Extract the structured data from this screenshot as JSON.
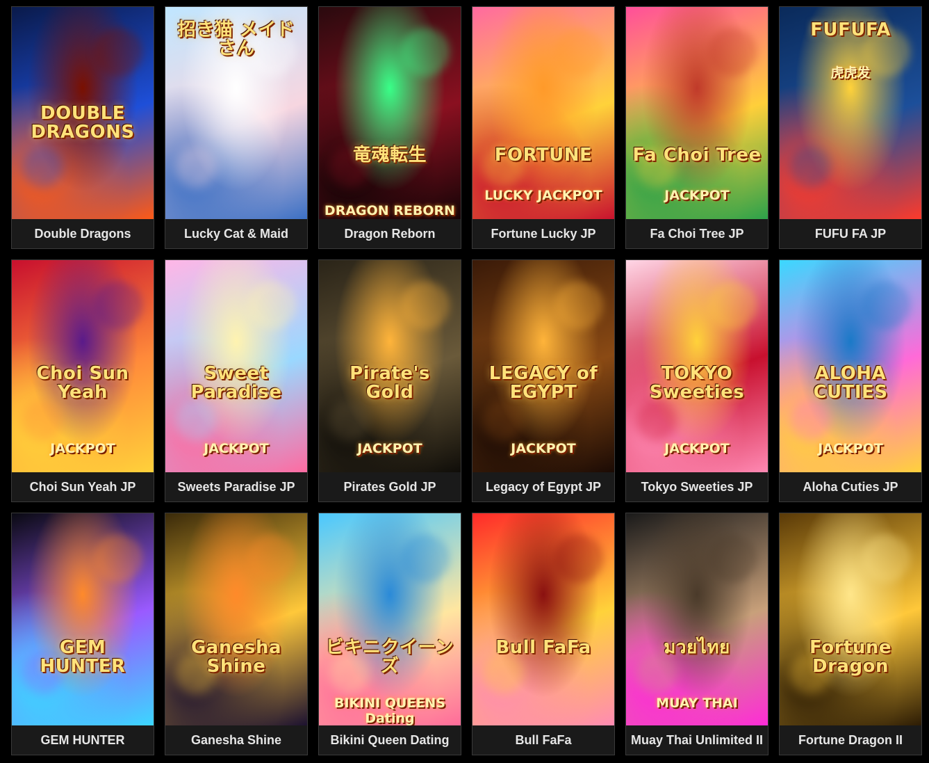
{
  "games": [
    {
      "name": "Double Dragons",
      "art_title": "DOUBLE DRAGONS",
      "art_sub": "",
      "colors": [
        "#0a1a4a",
        "#1e4fd8",
        "#ff5a14",
        "#7a1000"
      ]
    },
    {
      "name": "Lucky Cat & Maid",
      "art_title": "招き猫 メイドさん",
      "art_sub": "",
      "colors": [
        "#bfe6ff",
        "#f7d6e0",
        "#3a6fc4",
        "#ffffff"
      ]
    },
    {
      "name": "Dragon Reborn",
      "art_title": "竜魂転生",
      "art_sub": "DRAGON REBORN",
      "colors": [
        "#2a0a0e",
        "#8a1020",
        "#130406",
        "#39ff88"
      ]
    },
    {
      "name": "Fortune Lucky JP",
      "art_title": "FORTUNE",
      "art_sub": "LUCKY JACKPOT",
      "colors": [
        "#ff6aa0",
        "#ffd23a",
        "#c8102e",
        "#ff9a2a"
      ]
    },
    {
      "name": "Fa Choi Tree JP",
      "art_title": "Fa Choi Tree",
      "art_sub": "JACKPOT",
      "colors": [
        "#ff4f9a",
        "#ffcf3a",
        "#2aa14a",
        "#c03a2a"
      ]
    },
    {
      "name": "FUFU FA JP",
      "art_title": "FUFUFA",
      "art_sub": "虎虎发",
      "colors": [
        "#0a2a5a",
        "#1c4f9a",
        "#ff3a2a",
        "#ffd23a"
      ]
    },
    {
      "name": "Choi Sun Yeah JP",
      "art_title": "Choi Sun Yeah",
      "art_sub": "JACKPOT",
      "colors": [
        "#c8102e",
        "#ff8a3a",
        "#ffd23a",
        "#5a1a8a"
      ]
    },
    {
      "name": "Sweets Paradise JP",
      "art_title": "Sweet Paradise",
      "art_sub": "JACKPOT",
      "colors": [
        "#ffb6e6",
        "#9ad8ff",
        "#ff6aa0",
        "#fff3b0"
      ]
    },
    {
      "name": "Pirates Gold JP",
      "art_title": "Pirate's Gold",
      "art_sub": "JACKPOT",
      "colors": [
        "#2a2418",
        "#6a5a3a",
        "#0e0c08",
        "#ffb43a"
      ]
    },
    {
      "name": "Legacy of Egypt JP",
      "art_title": "LEGACY of EGYPT",
      "art_sub": "JACKPOT",
      "colors": [
        "#3a1a08",
        "#8a4a14",
        "#1a0a04",
        "#ffb43a"
      ]
    },
    {
      "name": "Tokyo Sweeties JP",
      "art_title": "TOKYO Sweeties",
      "art_sub": "JACKPOT",
      "colors": [
        "#ffd6e6",
        "#c8102e",
        "#ff8ab4",
        "#ffd23a"
      ]
    },
    {
      "name": "Aloha Cuties JP",
      "art_title": "ALOHA CUTIES",
      "art_sub": "JACKPOT",
      "colors": [
        "#3ad8ff",
        "#ff6ad8",
        "#ffd23a",
        "#1a7ac8"
      ]
    },
    {
      "name": "GEM HUNTER",
      "art_title": "GEM HUNTER",
      "art_sub": "",
      "colors": [
        "#0a0a12",
        "#9a5aff",
        "#3ad8ff",
        "#ff8a2a"
      ]
    },
    {
      "name": "Ganesha Shine",
      "art_title": "Ganesha Shine",
      "art_sub": "",
      "colors": [
        "#3a2a0a",
        "#ffc83a",
        "#1a1030",
        "#ff8a2a"
      ]
    },
    {
      "name": "Bikini Queen Dating",
      "art_title": "ビキニクイーンズ",
      "art_sub": "BIKINI QUEENS Dating",
      "colors": [
        "#4ac8ff",
        "#ffe6a0",
        "#ff6a9a",
        "#2a8ad8"
      ]
    },
    {
      "name": "Bull FaFa",
      "art_title": "Bull FaFa",
      "art_sub": "",
      "colors": [
        "#ff2a2a",
        "#ffd23a",
        "#ff8ab4",
        "#8a1010"
      ]
    },
    {
      "name": "Muay Thai Unlimited II",
      "art_title": "มวยไทย",
      "art_sub": "MUAY THAI",
      "colors": [
        "#1a1a1a",
        "#c8a07a",
        "#ff2ad8",
        "#4a3a2a"
      ]
    },
    {
      "name": "Fortune Dragon II",
      "art_title": "Fortune Dragon",
      "art_sub": "",
      "colors": [
        "#5a3a08",
        "#ffc83a",
        "#2a1a04",
        "#ffe68a"
      ]
    }
  ]
}
